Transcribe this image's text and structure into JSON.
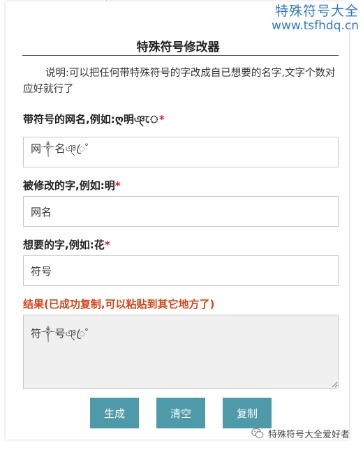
{
  "watermark": {
    "line1": "特殊符号大全",
    "line2": "www.tsfhdq.cn"
  },
  "form": {
    "title": "特殊符号修改器",
    "description": "说明:可以把任何带特殊符号的字改成自已想要的名字,文字个数对应好就行了",
    "symbol_name": {
      "label": "带符号的网名,例如:ღ明ঞ্ে",
      "value": "网༒名ঞ্ꦿ゜"
    },
    "modified_char": {
      "label": "被修改的字,例如:明",
      "value": "网名"
    },
    "wanted_char": {
      "label": "想要的字,例如:花",
      "value": "符号"
    },
    "result": {
      "label": "结果(已成功复制,可以粘贴到其它地方了)",
      "value": "符༒号ঞ্ꦿ゜"
    },
    "required_mark": "*",
    "buttons": {
      "generate": "生成",
      "clear": "清空",
      "copy": "复制"
    }
  },
  "footer_badge": {
    "text": "特殊符号大全爱好者"
  },
  "colors": {
    "button": "#4f9aaa",
    "watermark": "#2f78c4",
    "result_label": "#d0451b",
    "required": "#e02020"
  }
}
